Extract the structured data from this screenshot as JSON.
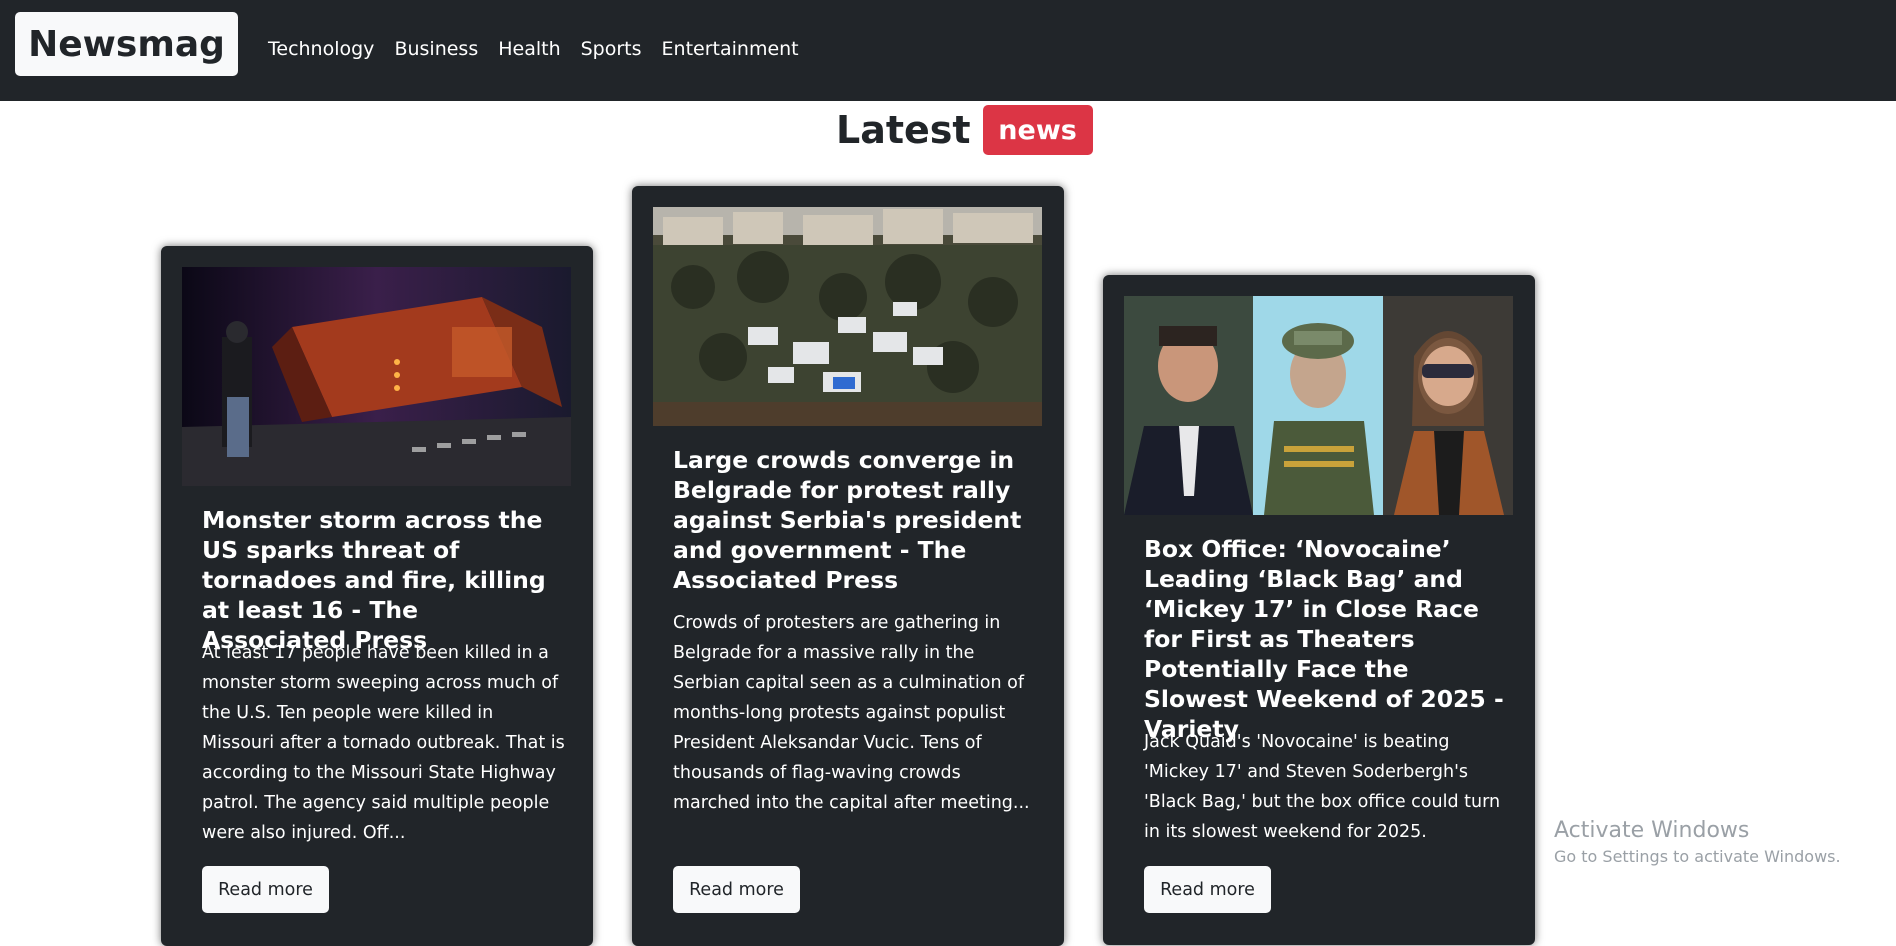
{
  "navbar": {
    "brand": "Newsmag",
    "links": [
      "Technology",
      "Business",
      "Health",
      "Sports",
      "Entertainment"
    ]
  },
  "heading": {
    "text": "Latest",
    "badge": "news"
  },
  "cards": [
    {
      "title": "Monster storm across the US sparks threat of tornadoes and fire, killing at least 16 - The Associated Press",
      "description": "At least 17 people have been killed in a monster storm sweeping across much of the U.S. Ten people were killed in Missouri after a tornado outbreak. That is according to the Missouri State Highway patrol. The agency said multiple people were also injured. Off...",
      "button": "Read more"
    },
    {
      "title": "Large crowds converge in Belgrade for protest rally against Serbia's president and government - The Associated Press",
      "description": "Crowds of protesters are gathering in Belgrade for a massive rally in the Serbian capital seen as a culmination of months-long protests against populist President Aleksandar Vucic. Tens of thousands of flag-waving crowds marched into the capital after meeting...",
      "button": "Read more"
    },
    {
      "title": "Box Office: ‘Novocaine’ Leading ‘Black Bag’ and ‘Mickey 17’ in Close Race for First as Theaters Potentially Face the Slowest Weekend of 2025 - Variety",
      "description": "Jack Quaid's 'Novocaine' is beating 'Mickey 17' and Steven Soderbergh's 'Black Bag,' but the box office could turn in its slowest weekend for 2025.",
      "button": "Read more"
    }
  ],
  "watermark": {
    "title": "Activate Windows",
    "subtitle": "Go to Settings to activate Windows."
  },
  "colors": {
    "navbar": "#212529",
    "card": "#212529",
    "badge": "#dc3545",
    "button": "#f8f9fa"
  }
}
